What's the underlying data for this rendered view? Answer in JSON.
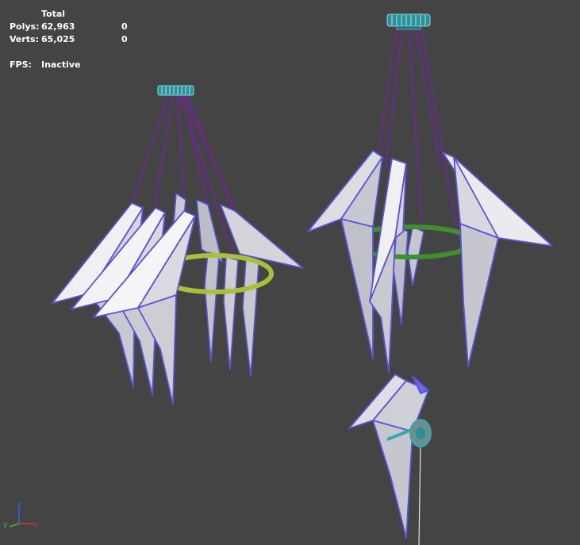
{
  "stats": {
    "header": "Total",
    "polys_label": "Polys:",
    "polys_total": "62,963",
    "polys_selected": "0",
    "verts_label": "Verts:",
    "verts_total": "65,025",
    "verts_selected": "0",
    "fps_label": "FPS:",
    "fps_value": "Inactive"
  },
  "colors": {
    "background": "#444444",
    "bird_fill": "#d8d8de",
    "bird_edge": "#5a55d8",
    "cable": "#6a2a8a",
    "ring_left": "#a7c23a",
    "ring_right": "#3e8f2e",
    "canopy": "#34a7b3"
  },
  "axis": {
    "z": "z",
    "x": "x",
    "y": "y"
  }
}
